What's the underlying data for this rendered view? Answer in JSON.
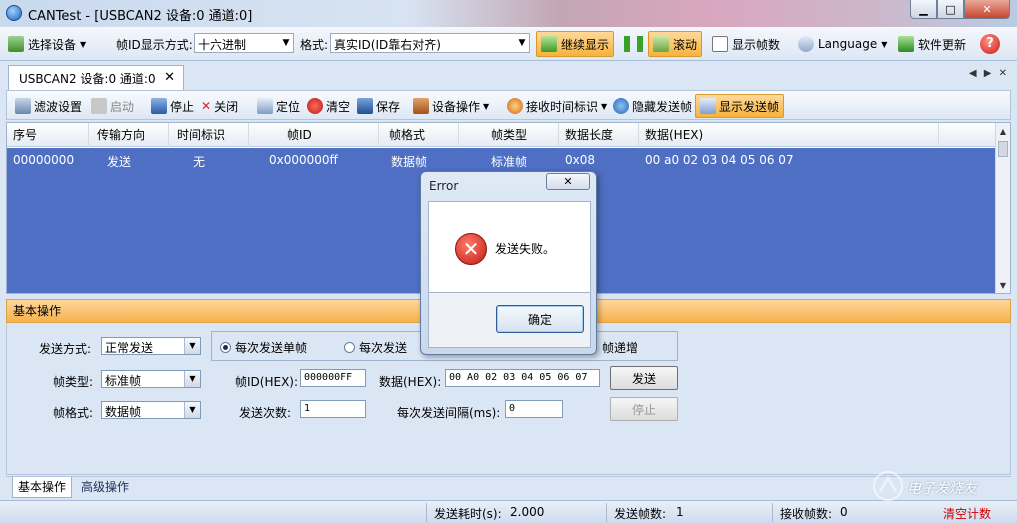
{
  "window": {
    "title": "CANTest - [USBCAN2 设备:0 通道:0]",
    "minimize": "▁",
    "maximize": "□",
    "close": "✕"
  },
  "toolbar": {
    "select_device": "选择设备",
    "frame_id_format_label": "帧ID显示方式:",
    "frame_id_format_value": "十六进制",
    "format_label": "格式:",
    "format_value": "真实ID(ID靠右对齐)",
    "continue_display": "继续显示",
    "scroll": "滚动",
    "show_frame_count": "显示帧数",
    "language": "Language",
    "software_update": "软件更新"
  },
  "tab": {
    "label": "USBCAN2 设备:0 通道:0",
    "close": "✕",
    "nav": "◀ ▶ ✕"
  },
  "toolbar2": {
    "filter_settings": "滤波设置",
    "start": "启动",
    "stop": "停止",
    "close": "关闭",
    "locate": "定位",
    "clear": "清空",
    "save": "保存",
    "device_ops": "设备操作",
    "rx_time_stamp": "接收时间标识",
    "hide_sent": "隐藏发送帧",
    "show_sent": "显示发送帧"
  },
  "grid": {
    "columns": [
      "序号",
      "传输方向",
      "时间标识",
      "帧ID",
      "帧格式",
      "帧类型",
      "数据长度",
      "数据(HEX)"
    ],
    "rows": [
      [
        "00000000",
        "发送",
        "无",
        "0x000000ff",
        "数据帧",
        "标准帧",
        "0x08",
        "00 a0 02 03 04 05 06 07"
      ]
    ]
  },
  "panel": {
    "header": "基本操作",
    "send_mode_label": "发送方式:",
    "send_mode_value": "正常发送",
    "radio_single": "每次发送单帧",
    "radio_multi": "每次发送",
    "radio_incr": "帧递增",
    "frame_type_label": "帧类型:",
    "frame_type_value": "标准帧",
    "frame_id_label": "帧ID(HEX):",
    "frame_id_value": "000000FF",
    "data_label": "数据(HEX):",
    "data_value": "00 A0 02 03 04 05 06 07",
    "send_button": "发送",
    "frame_format_label": "帧格式:",
    "frame_format_value": "数据帧",
    "send_count_label": "发送次数:",
    "send_count_value": "1",
    "interval_label": "每次发送间隔(ms):",
    "interval_value": "0",
    "stop_button": "停止"
  },
  "bottom_tabs": {
    "basic": "基本操作",
    "advanced": "高级操作"
  },
  "status": {
    "send_time_label": "发送耗时(s):",
    "send_time_value": "2.000",
    "sent_frames_label": "发送帧数:",
    "sent_frames_value": "1",
    "recv_frames_label": "接收帧数:",
    "recv_frames_value": "0",
    "clear_count": "清空计数"
  },
  "dialog": {
    "title": "Error",
    "close": "✕",
    "message": "发送失败。",
    "ok": "确定",
    "icon": "✕"
  },
  "watermark": "电子发烧友",
  "colors": {
    "selection": "#4e6fc4",
    "accent_orange": "#f7b23c",
    "error_red": "#c11d14"
  }
}
